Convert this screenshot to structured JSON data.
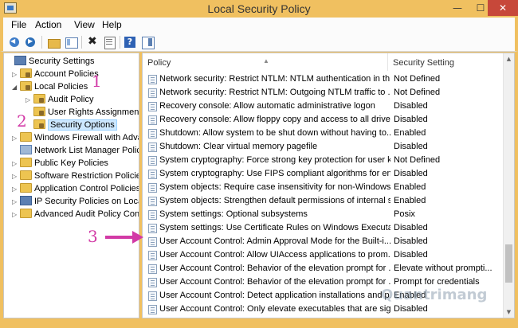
{
  "window": {
    "title": "Local Security Policy"
  },
  "menu": [
    "File",
    "Action",
    "View",
    "Help"
  ],
  "toolbar": [
    "back-icon",
    "forward-icon",
    "up-folder-icon",
    "show-hide-tree-icon",
    "delete-icon",
    "properties-icon",
    "help-icon",
    "show-action-pane-icon"
  ],
  "tree": [
    {
      "label": "Security Settings",
      "expander": "",
      "icon": "shield"
    },
    {
      "label": "Account Policies",
      "expander": "▷",
      "icon": "folder"
    },
    {
      "label": "Local Policies",
      "expander": "◢",
      "icon": "folder"
    },
    {
      "label": "Audit Policy",
      "expander": "▷",
      "icon": "folder"
    },
    {
      "label": "User Rights Assignment",
      "expander": "",
      "icon": "folder"
    },
    {
      "label": "Security Options",
      "expander": "",
      "icon": "folder"
    },
    {
      "label": "Windows Firewall with Adva",
      "expander": "▷",
      "icon": "folder"
    },
    {
      "label": "Network List Manager Polic",
      "expander": "",
      "icon": "network"
    },
    {
      "label": "Public Key Policies",
      "expander": "▷",
      "icon": "folder"
    },
    {
      "label": "Software Restriction Policies",
      "expander": "▷",
      "icon": "folder"
    },
    {
      "label": "Application Control Policies",
      "expander": "▷",
      "icon": "folder"
    },
    {
      "label": "IP Security Policies on Local",
      "expander": "▷",
      "icon": "shield"
    },
    {
      "label": "Advanced Audit Policy Con",
      "expander": "▷",
      "icon": "folder"
    }
  ],
  "columns": {
    "policy": "Policy",
    "setting": "Security Setting"
  },
  "policies": [
    {
      "name": "Network security: Restrict NTLM: NTLM authentication in th...",
      "setting": "Not Defined"
    },
    {
      "name": "Network security: Restrict NTLM: Outgoing NTLM traffic to ...",
      "setting": "Not Defined"
    },
    {
      "name": "Recovery console: Allow automatic administrative logon",
      "setting": "Disabled"
    },
    {
      "name": "Recovery console: Allow floppy copy and access to all drives...",
      "setting": "Disabled"
    },
    {
      "name": "Shutdown: Allow system to be shut down without having to...",
      "setting": "Enabled"
    },
    {
      "name": "Shutdown: Clear virtual memory pagefile",
      "setting": "Disabled"
    },
    {
      "name": "System cryptography: Force strong key protection for user k...",
      "setting": "Not Defined"
    },
    {
      "name": "System cryptography: Use FIPS compliant algorithms for en...",
      "setting": "Disabled"
    },
    {
      "name": "System objects: Require case insensitivity for non-Windows ...",
      "setting": "Enabled"
    },
    {
      "name": "System objects: Strengthen default permissions of internal s...",
      "setting": "Enabled"
    },
    {
      "name": "System settings: Optional subsystems",
      "setting": "Posix"
    },
    {
      "name": "System settings: Use Certificate Rules on Windows Executabl...",
      "setting": "Disabled"
    },
    {
      "name": "User Account Control: Admin Approval Mode for the Built-i...",
      "setting": "Disabled"
    },
    {
      "name": "User Account Control: Allow UIAccess applications to prom...",
      "setting": "Disabled"
    },
    {
      "name": "User Account Control: Behavior of the elevation prompt for ...",
      "setting": "Elevate without prompti..."
    },
    {
      "name": "User Account Control: Behavior of the elevation prompt for ...",
      "setting": "Prompt for credentials"
    },
    {
      "name": "User Account Control: Detect application installations and p...",
      "setting": "Enabled"
    },
    {
      "name": "User Account Control: Only elevate executables that are sign...",
      "setting": "Disabled"
    }
  ],
  "annotations": {
    "one": "1",
    "two": "2",
    "three": "3"
  },
  "watermark": "Quantrimang"
}
